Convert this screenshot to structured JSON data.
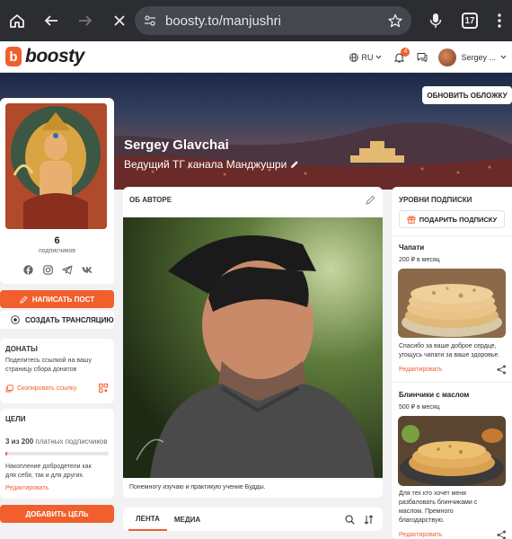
{
  "browser": {
    "url": "boosty.to/manjushri",
    "tab_count": "17"
  },
  "header": {
    "logo_text": "boosty",
    "language": "RU",
    "notifications_count": "4",
    "username": "Sergey ..."
  },
  "cover": {
    "update_cover_label": "ОБНОВИТЬ ОБЛОЖКУ",
    "author_name": "Sergey Glavchai",
    "tagline": "Ведущий ТГ канала Манджушри"
  },
  "profile": {
    "subscribers_count": "6",
    "subscribers_label": "подписчиков",
    "socials": [
      "facebook-icon",
      "instagram-icon",
      "telegram-icon",
      "vk-icon"
    ]
  },
  "actions": {
    "write_post": "НАПИСАТЬ ПОСТ",
    "create_stream": "СОЗДАТЬ ТРАНСЛЯЦИЮ"
  },
  "donations": {
    "title": "ДОНАТЫ",
    "description_line1": "Поделитесь ссылкой на вашу",
    "description_line2": "страницу сбора донатов",
    "copy_link": "Скопировать ссылку"
  },
  "goal": {
    "title": "ЦЕЛИ",
    "progress_text_bold": "3 из 200",
    "progress_text_rest": "платных подписчиков",
    "progress_fraction": 0.015,
    "description_line1": "Накопление добродетели как",
    "description_line2": "для себя, так и для других.",
    "edit": "Редактировать",
    "add_goal": "ДОБАВИТЬ ЦЕЛЬ"
  },
  "about": {
    "title": "ОБ АВТОРЕ",
    "caption": "Понемногу изучаю и практикую учение Будды."
  },
  "feed": {
    "tabs": [
      "ЛЕНТА",
      "МЕДИА"
    ]
  },
  "tiers": {
    "title": "УРОВНИ ПОДПИСКИ",
    "gift_button": "ПОДАРИТЬ ПОДПИСКУ",
    "items": [
      {
        "name": "Чапати",
        "price": "200 ₽ в месяц",
        "desc_line1": "Спасибо за ваше доброе сердце,",
        "desc_line2": "угощусь чапати за ваше здоровье.",
        "edit": "Редактировать"
      },
      {
        "name": "Блинчики с маслом",
        "price": "500 ₽ в месяц",
        "desc_line1": "Для тех кто хочет меня",
        "desc_line2": "разбаловать блинчиками с",
        "desc_line3": "маслом. Премного",
        "desc_line4": "благодарствую.",
        "edit": "Редактировать"
      }
    ]
  }
}
